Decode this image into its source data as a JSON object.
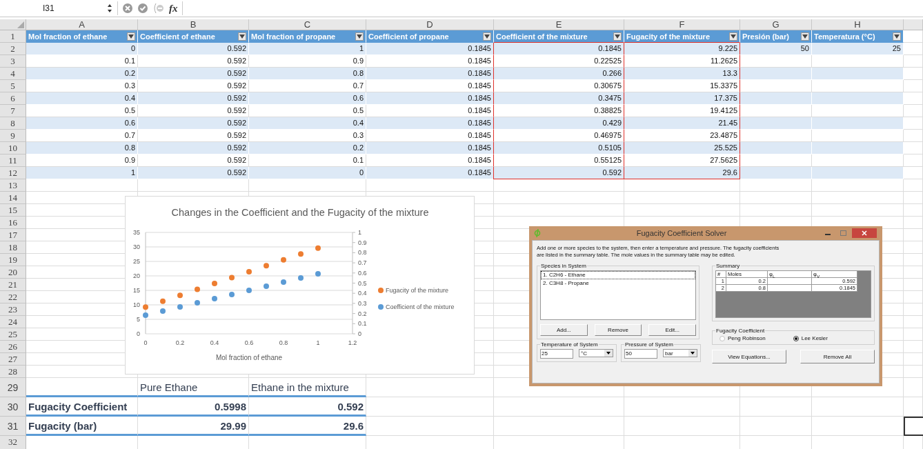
{
  "formula_bar": {
    "name_box": "I31",
    "function_label": "fx"
  },
  "sheet": {
    "column_letters": [
      "A",
      "B",
      "C",
      "D",
      "E",
      "F",
      "G",
      "H"
    ],
    "row_numbers": [
      "1",
      "2",
      "3",
      "4",
      "5",
      "6",
      "7",
      "8",
      "9",
      "10",
      "11",
      "12",
      "13",
      "14",
      "15",
      "16",
      "17",
      "18",
      "19",
      "20",
      "21",
      "22",
      "23",
      "24",
      "25",
      "26",
      "27",
      "28",
      "29",
      "30",
      "31",
      "32"
    ]
  },
  "table": {
    "headers": [
      {
        "label": "Mol fraction of ethane",
        "highlighted": false
      },
      {
        "label": "Coefficient of ethane",
        "highlighted": false
      },
      {
        "label": "Mol fraction of propane",
        "highlighted": false
      },
      {
        "label": "Coefficient of propane",
        "highlighted": false
      },
      {
        "label": "Coefficient of the mixture",
        "highlighted": true
      },
      {
        "label": "Fugacity of the mixture",
        "highlighted": true
      },
      {
        "label": "Presión (bar)",
        "highlighted": false
      },
      {
        "label": "Temperatura (°C)",
        "highlighted": false
      }
    ],
    "rows": [
      {
        "cells": [
          "0",
          "0.592",
          "1",
          "0.1845",
          "0.1845",
          "9.225",
          "50",
          "25"
        ]
      },
      {
        "cells": [
          "0.1",
          "0.592",
          "0.9",
          "0.1845",
          "0.22525",
          "11.2625"
        ]
      },
      {
        "cells": [
          "0.2",
          "0.592",
          "0.8",
          "0.1845",
          "0.266",
          "13.3"
        ]
      },
      {
        "cells": [
          "0.3",
          "0.592",
          "0.7",
          "0.1845",
          "0.30675",
          "15.3375"
        ]
      },
      {
        "cells": [
          "0.4",
          "0.592",
          "0.6",
          "0.1845",
          "0.3475",
          "17.375"
        ]
      },
      {
        "cells": [
          "0.5",
          "0.592",
          "0.5",
          "0.1845",
          "0.38825",
          "19.4125"
        ]
      },
      {
        "cells": [
          "0.6",
          "0.592",
          "0.4",
          "0.1845",
          "0.429",
          "21.45"
        ]
      },
      {
        "cells": [
          "0.7",
          "0.592",
          "0.3",
          "0.1845",
          "0.46975",
          "23.4875"
        ]
      },
      {
        "cells": [
          "0.8",
          "0.592",
          "0.2",
          "0.1845",
          "0.5105",
          "25.525"
        ]
      },
      {
        "cells": [
          "0.9",
          "0.592",
          "0.1",
          "0.1845",
          "0.55125",
          "27.5625"
        ]
      },
      {
        "cells": [
          "1",
          "0.592",
          "0",
          "0.1845",
          "0.592",
          "29.6"
        ]
      }
    ]
  },
  "chart": {
    "chart_data": {
      "type": "scatter",
      "title": "Changes in the Coefficient and the Fugacity of the mixture",
      "xlabel": "Mol fraction of ethane",
      "x": [
        0,
        0.1,
        0.2,
        0.3,
        0.4,
        0.5,
        0.6,
        0.7,
        0.8,
        0.9,
        1
      ],
      "series": [
        {
          "name": "Fugacity of the mixture",
          "color": "#ed7d31",
          "axis": "y",
          "values": [
            9.225,
            11.2625,
            13.3,
            15.3375,
            17.375,
            19.4125,
            21.45,
            23.4875,
            25.525,
            27.5625,
            29.6
          ]
        },
        {
          "name": "Coefficient of the mixture",
          "color": "#5b9bd5",
          "axis": "y2",
          "values": [
            0.1845,
            0.22525,
            0.266,
            0.30675,
            0.3475,
            0.38825,
            0.429,
            0.46975,
            0.5105,
            0.55125,
            0.592
          ]
        }
      ],
      "xlim": [
        0,
        1.2
      ],
      "ylim": [
        0,
        35
      ],
      "y2lim": [
        0,
        1
      ],
      "xticks": [
        {
          "value": 0,
          "label": "0"
        },
        {
          "value": 0.2,
          "label": "0.2"
        },
        {
          "value": 0.4,
          "label": "0.4"
        },
        {
          "value": 0.6,
          "label": "0.6"
        },
        {
          "value": 0.8,
          "label": "0.8"
        },
        {
          "value": 1,
          "label": "1"
        },
        {
          "value": 1.2,
          "label": "1.2"
        }
      ],
      "yticks": [
        {
          "value": 0,
          "label": "0"
        },
        {
          "value": 5,
          "label": "5"
        },
        {
          "value": 10,
          "label": "10"
        },
        {
          "value": 15,
          "label": "15"
        },
        {
          "value": 20,
          "label": "20"
        },
        {
          "value": 25,
          "label": "25"
        },
        {
          "value": 30,
          "label": "30"
        },
        {
          "value": 35,
          "label": "35"
        }
      ],
      "y2ticks": [
        {
          "value": 0,
          "label": "0"
        },
        {
          "value": 0.1,
          "label": "0.1"
        },
        {
          "value": 0.2,
          "label": "0.2"
        },
        {
          "value": 0.3,
          "label": "0.3"
        },
        {
          "value": 0.4,
          "label": "0.4"
        },
        {
          "value": 0.5,
          "label": "0.5"
        },
        {
          "value": 0.6,
          "label": "0.6"
        },
        {
          "value": 0.7,
          "label": "0.7"
        },
        {
          "value": 0.8,
          "label": "0.8"
        },
        {
          "value": 0.9,
          "label": "0.9"
        },
        {
          "value": 1,
          "label": "1"
        }
      ],
      "grid": true,
      "legend": true
    }
  },
  "summary": {
    "headers": [
      "Pure Ethane",
      "Ethane in the mixture"
    ],
    "rows": [
      {
        "label": "Fugacity Coefficient",
        "values": [
          "0.5998",
          "0.592"
        ]
      },
      {
        "label": "Fugacity (bar)",
        "values": [
          "29.99",
          "29.6"
        ]
      }
    ]
  },
  "dialog": {
    "title": "Fugacity Coefficient Solver",
    "description": "Add one or more species to the system, then enter a temperature and pressure.  The fugacity coefficients are listed in the summary table.  The mole values in the summary table may be edited.",
    "species_group": {
      "label": "Species in System",
      "items": [
        {
          "label": "1.  C2H6 - Ethane",
          "selected": true
        },
        {
          "label": "2.  C3H8 - Propane",
          "selected": false
        }
      ],
      "buttons": [
        "Add...",
        "Remove",
        "Edit..."
      ]
    },
    "summary_group": {
      "label": "Summary",
      "columns": [
        "#",
        "Moles",
        "φ$_{L}$",
        "φ$_{V}$"
      ],
      "rows": [
        {
          "index": "1",
          "moles": "0.2",
          "column_4": "0.592"
        },
        {
          "index": "2",
          "moles": "0.8",
          "column_4": "0.1845"
        }
      ]
    },
    "temperature_group": {
      "label": "Temperature of System",
      "value": "25",
      "unit": "°C"
    },
    "pressure_group": {
      "label": "Pressure of System",
      "value": "50",
      "unit": "bar"
    },
    "fugacity_coefficient_group": {
      "label": "Fugacity Coefficient",
      "options": [
        {
          "label": "Peng Robinson",
          "selected": false
        },
        {
          "label": "Lee Kesler",
          "selected": true
        }
      ]
    },
    "buttons": [
      "View Equations...",
      "Remove All"
    ]
  }
}
